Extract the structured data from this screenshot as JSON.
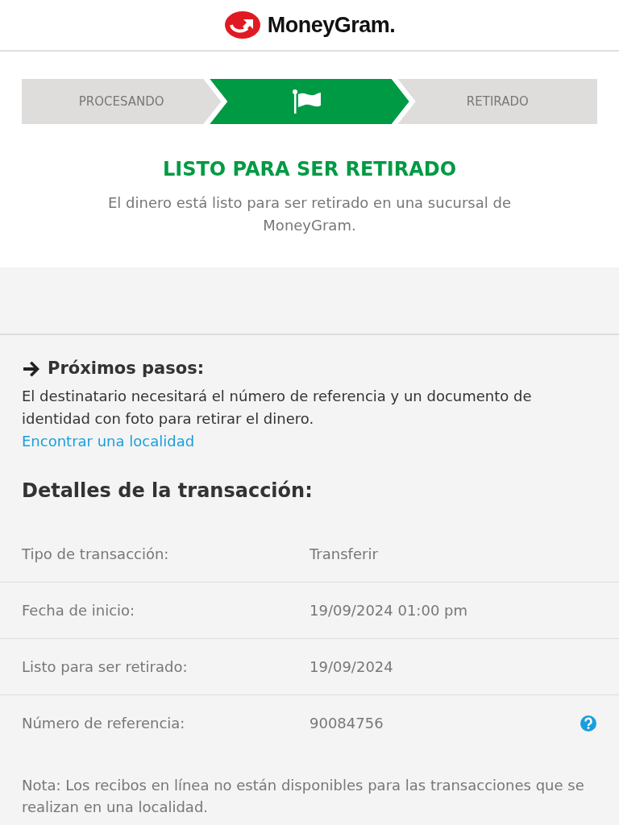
{
  "header": {
    "brand": "MoneyGram."
  },
  "steps": [
    {
      "kind": "label",
      "label": "PROCESANDO",
      "selected": false
    },
    {
      "kind": "flag",
      "selected": true
    },
    {
      "kind": "label",
      "label": "RETIRADO",
      "selected": false
    }
  ],
  "status": {
    "title": "LISTO PARA SER RETIRADO",
    "message": "El dinero está listo para ser retirado en una sucursal de MoneyGram."
  },
  "next_steps": {
    "title": "Próximos pasos:",
    "text": "El destinatario necesitará el número de referencia y un documento de identidad con foto para retirar el dinero.",
    "link": "Encontrar una localidad"
  },
  "details": {
    "title": "Detalles de la transacción:",
    "rows": [
      {
        "label": "Tipo de transacción:",
        "value": "Transferir",
        "help": false
      },
      {
        "label": "Fecha de inicio:",
        "value": "19/09/2024 01:00 pm",
        "help": false
      },
      {
        "label": "Listo para ser retirado:",
        "value": "19/09/2024",
        "help": false
      },
      {
        "label": "Número de referencia:",
        "value": "90084756",
        "help": true
      }
    ]
  },
  "note": "Nota: Los recibos en línea no están disponibles para las transacciones que se realizan en una localidad."
}
